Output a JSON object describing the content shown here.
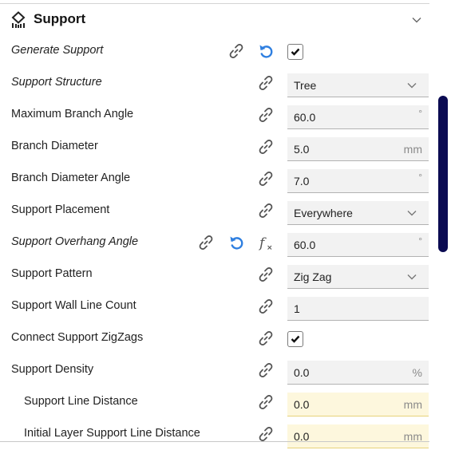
{
  "section": {
    "title": "Support",
    "icon": "support-category-icon",
    "collapse_icon": "chevron-down-icon"
  },
  "colors": {
    "accent_reset": "#2f7fe0",
    "scrollbar": "#0b0b52",
    "warning_field": "#fdf7dd",
    "field_bg": "#f2f2f2"
  },
  "settings": [
    {
      "label": "Generate Support",
      "italic": true,
      "type": "checkbox",
      "checked": true,
      "icons": [
        "link-icon",
        "reset-icon"
      ]
    },
    {
      "label": "Support Structure",
      "italic": true,
      "type": "dropdown",
      "value": "Tree",
      "icons": [
        "link-icon"
      ]
    },
    {
      "label": "Maximum Branch Angle",
      "type": "number",
      "value": "60.0",
      "unit": "°",
      "icons": [
        "link-icon"
      ]
    },
    {
      "label": "Branch Diameter",
      "type": "number",
      "value": "5.0",
      "unit": "mm",
      "icons": [
        "link-icon"
      ]
    },
    {
      "label": "Branch Diameter Angle",
      "type": "number",
      "value": "7.0",
      "unit": "°",
      "icons": [
        "link-icon"
      ]
    },
    {
      "label": "Support Placement",
      "type": "dropdown",
      "value": "Everywhere",
      "icons": [
        "link-icon"
      ]
    },
    {
      "label": "Support Overhang Angle",
      "italic": true,
      "type": "number",
      "value": "60.0",
      "unit": "°",
      "icons": [
        "link-icon",
        "reset-icon",
        "function-icon"
      ]
    },
    {
      "label": "Support Pattern",
      "type": "dropdown",
      "value": "Zig Zag",
      "icons": [
        "link-icon"
      ]
    },
    {
      "label": "Support Wall Line Count",
      "type": "number",
      "value": "1",
      "unit": "",
      "icons": [
        "link-icon"
      ]
    },
    {
      "label": "Connect Support ZigZags",
      "type": "checkbox",
      "checked": true,
      "icons": [
        "link-icon"
      ]
    },
    {
      "label": "Support Density",
      "type": "number",
      "value": "0.0",
      "unit": "%",
      "icons": [
        "link-icon"
      ]
    },
    {
      "label": "Support Line Distance",
      "indent": true,
      "type": "number",
      "value": "0.0",
      "unit": "mm",
      "warning": true,
      "icons": [
        "link-icon"
      ]
    },
    {
      "label": "Initial Layer Support Line Distance",
      "indent": true,
      "type": "number",
      "value": "0.0",
      "unit": "mm",
      "warning": true,
      "icons": [
        "link-icon"
      ]
    }
  ]
}
